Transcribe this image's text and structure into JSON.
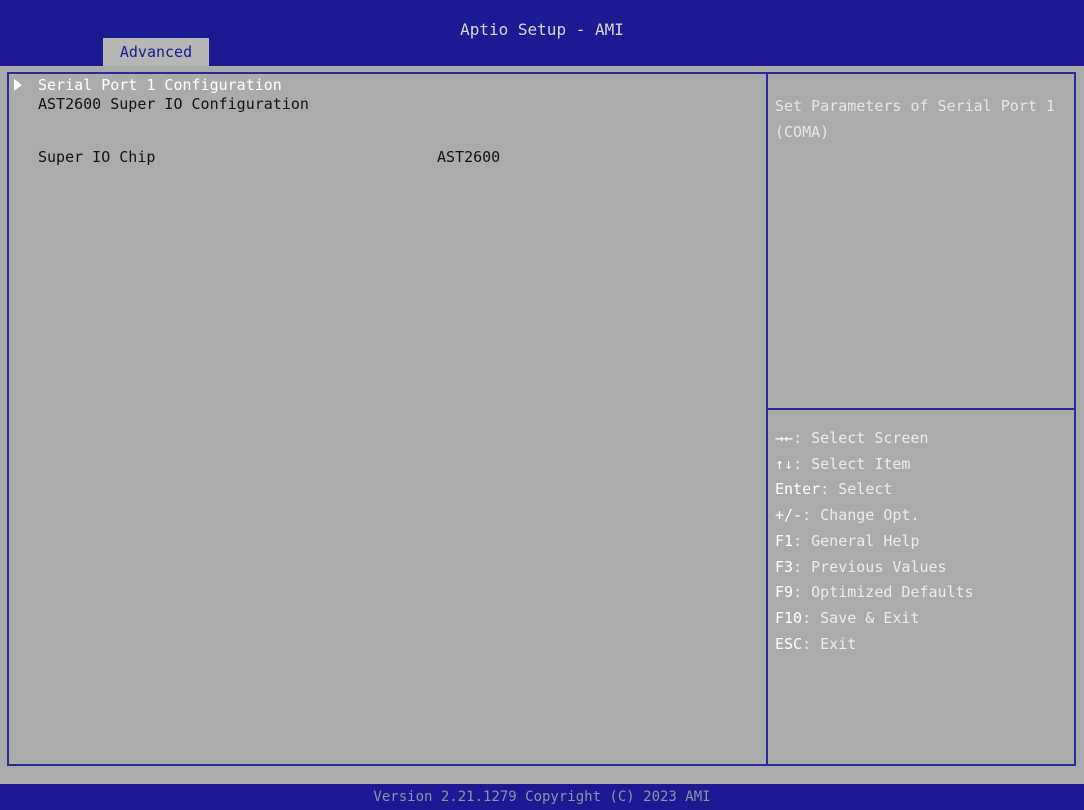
{
  "header": {
    "title": "Aptio Setup - AMI",
    "tabs": [
      {
        "label": "Advanced",
        "active": true
      }
    ]
  },
  "main": {
    "section_title": "AST2600 Super IO Configuration",
    "items": [
      {
        "label": "Super IO Chip",
        "value": "AST2600",
        "selectable": false
      },
      {
        "label": "Serial Port 1 Configuration",
        "value": "",
        "selectable": true,
        "submenu": true,
        "highlighted": true
      }
    ]
  },
  "help": {
    "text": "Set Parameters of Serial Port 1 (COMA)"
  },
  "key_legend": [
    {
      "key": "→←",
      "action": ": Select Screen"
    },
    {
      "key": "↑↓",
      "action": ": Select Item"
    },
    {
      "key": "Enter",
      "action": ": Select"
    },
    {
      "key": "+/-",
      "action": ": Change Opt."
    },
    {
      "key": "F1",
      "action": ": General Help"
    },
    {
      "key": "F3",
      "action": ": Previous Values"
    },
    {
      "key": "F9",
      "action": ": Optimized Defaults"
    },
    {
      "key": "F10",
      "action": ": Save & Exit"
    },
    {
      "key": "ESC",
      "action": ": Exit"
    }
  ],
  "footer": {
    "text": "Version 2.21.1279 Copyright (C) 2023 AMI"
  },
  "colors": {
    "header_blue": "#1b1a93",
    "panel_grey": "#ababab",
    "tab_grey": "#b6b6b6",
    "divider_blue": "#2a2a9a",
    "highlight_text": "#ffffff"
  },
  "icons": {
    "submenu_marker": "triangle-right-icon"
  }
}
